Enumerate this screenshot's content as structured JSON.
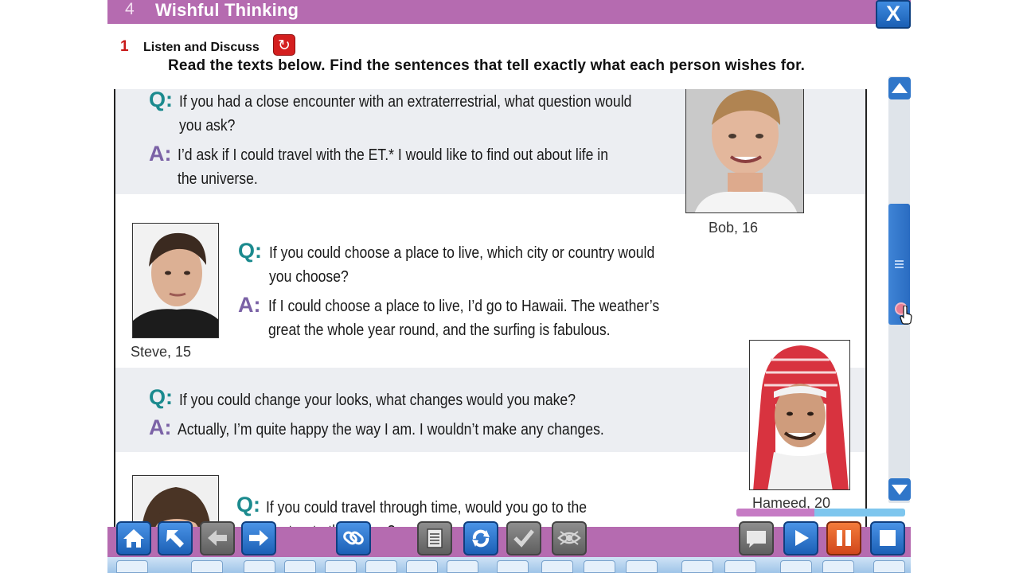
{
  "header": {
    "unit_number": "4",
    "unit_title": "Wishful Thinking",
    "close_label": "X"
  },
  "section": {
    "number": "1",
    "title": "Listen and Discuss",
    "instruction": "Read the texts below. Find the sentences that tell exactly what each person wishes for."
  },
  "content": {
    "q_marker": "Q:",
    "a_marker": "A:",
    "bob": {
      "q_line1": "If you had a close encounter with an extraterrestrial, what question would",
      "q_line2": "you ask?",
      "a_line1": "I’d ask if I could travel with the ET.* I would like to find out about life in",
      "a_line2": "the universe.",
      "caption": "Bob, 16"
    },
    "steve": {
      "q_line1": "If you could choose a place to live, which city or country would",
      "q_line2": "you choose?",
      "a_line1": "If I could choose a place to live, I’d go to Hawaii. The weather’s",
      "a_line2": "great the whole year round, and the surfing is fabulous.",
      "caption": "Steve, 15"
    },
    "hameed": {
      "q_line1": "If you could change your looks, what changes would you make?",
      "a_line1": "Actually, I’m quite happy the way I am. I wouldn’t make any changes.",
      "caption": "Hameed, 20"
    },
    "fourth": {
      "q_line1": "If you could travel through time, would you go to the",
      "q_line2": "past or to the future?"
    }
  },
  "progress": {
    "fraction": 0.46
  },
  "toolbar": {
    "home_icon": "home-icon",
    "colors": {
      "accent": "#b56bb0",
      "button_blue": "#2f76c9",
      "pause_orange": "#e05a25"
    }
  }
}
